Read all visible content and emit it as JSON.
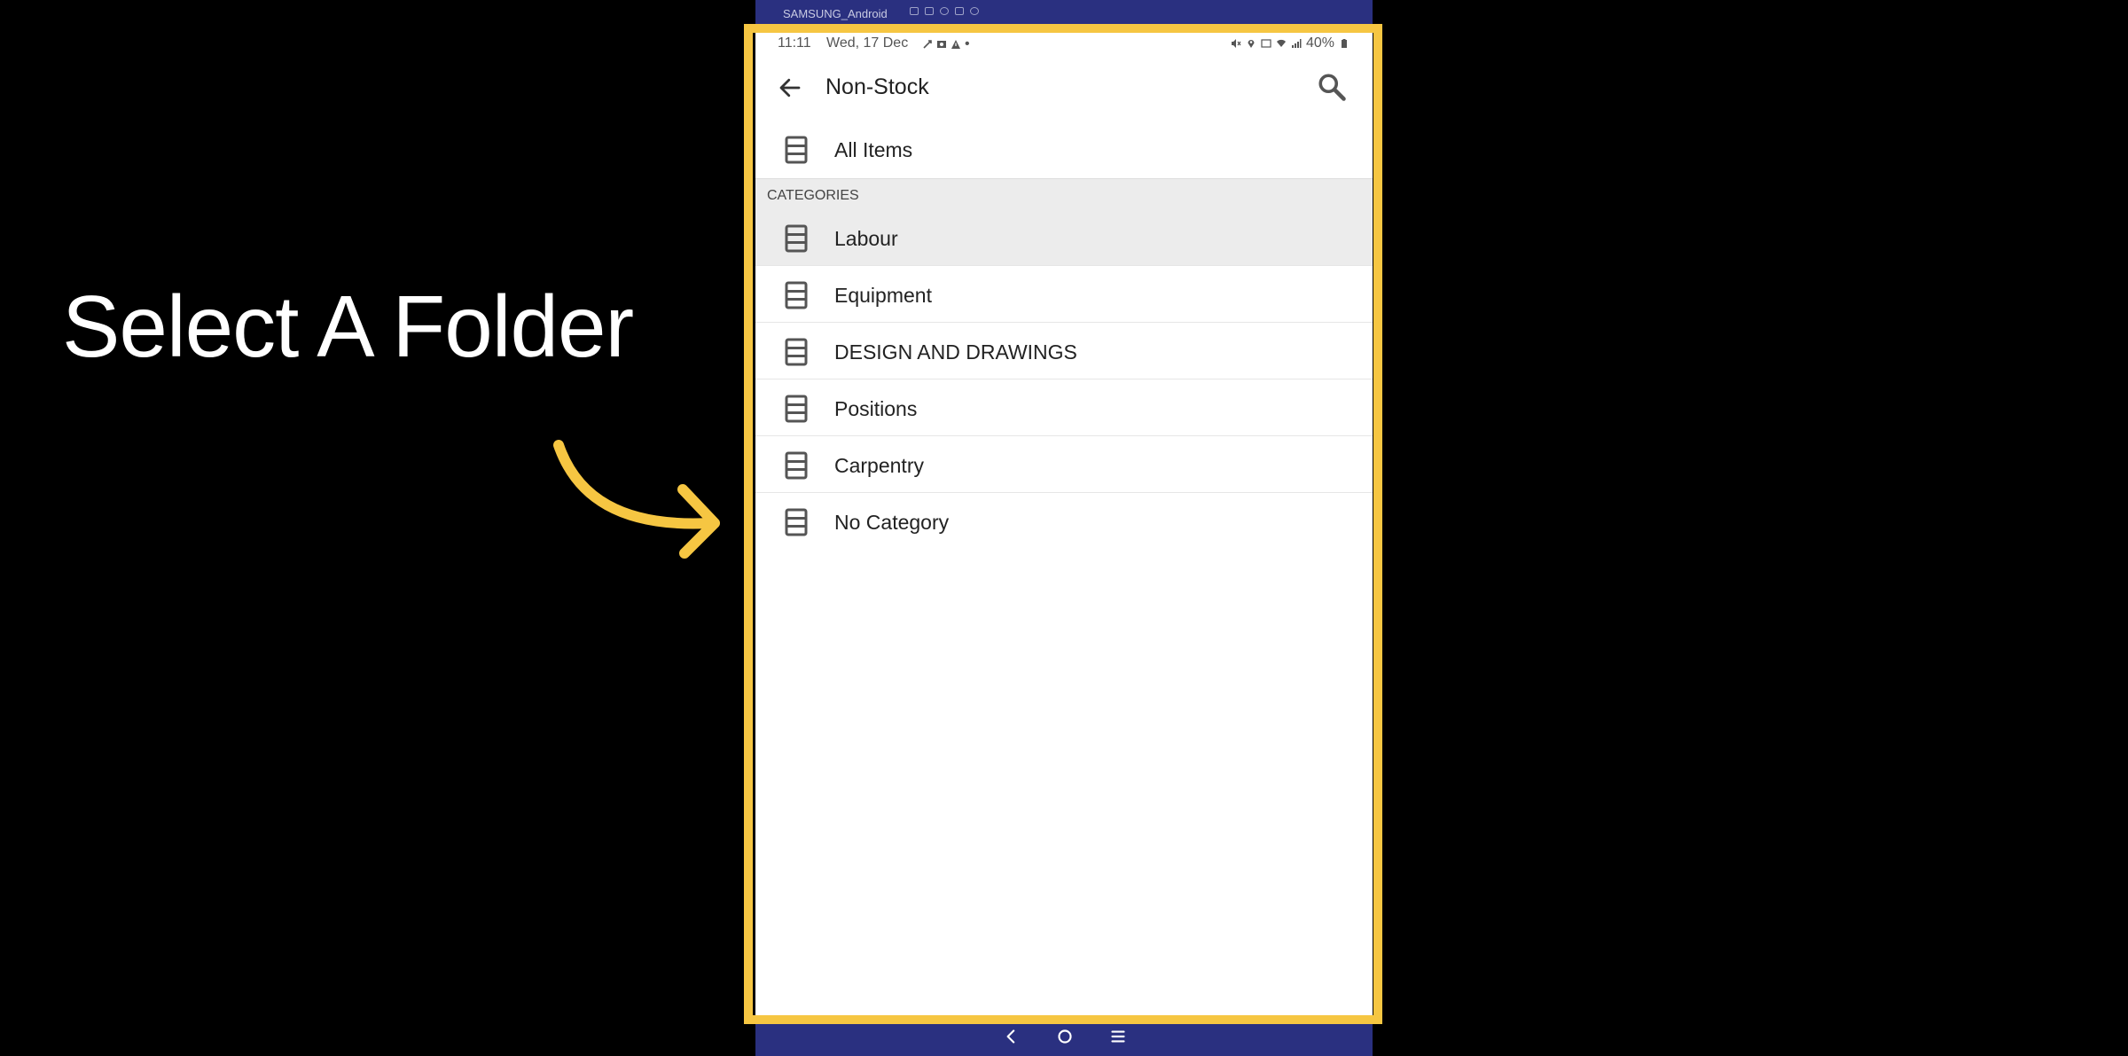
{
  "caption": "Select A Folder",
  "colors": {
    "highlight": "#f6c642",
    "device_chrome": "#2a3080",
    "app_background": "#ffffff"
  },
  "device": {
    "name": "SAMSUNG_Android",
    "toolbar_icons": [
      "camera-icon",
      "video-icon",
      "headphones-icon",
      "fullscreen-icon",
      "settings-icon"
    ]
  },
  "status_bar": {
    "time": "11:11",
    "date": "Wed, 17 Dec",
    "dot": "•",
    "battery": "40%",
    "notification_icons": [
      "link-icon",
      "image-icon",
      "warning-icon"
    ],
    "system_icons": [
      "mute-icon",
      "location-icon",
      "volte-icon",
      "wifi-icon",
      "signal-icon",
      "battery-icon"
    ]
  },
  "app_bar": {
    "title": "Non-Stock",
    "back_icon": "back-arrow-icon",
    "search_icon": "search-icon"
  },
  "all_items": {
    "label": "All Items",
    "icon": "list-icon"
  },
  "categories": {
    "header": "CATEGORIES",
    "items": [
      {
        "label": "Labour",
        "selected": true
      },
      {
        "label": "Equipment",
        "selected": false
      },
      {
        "label": "DESIGN AND DRAWINGS",
        "selected": false
      },
      {
        "label": "Positions",
        "selected": false
      },
      {
        "label": "Carpentry",
        "selected": false
      },
      {
        "label": "No Category",
        "selected": false
      }
    ]
  },
  "nav_bar": {
    "icons": [
      "nav-back-icon",
      "nav-home-icon",
      "nav-recents-icon"
    ]
  }
}
